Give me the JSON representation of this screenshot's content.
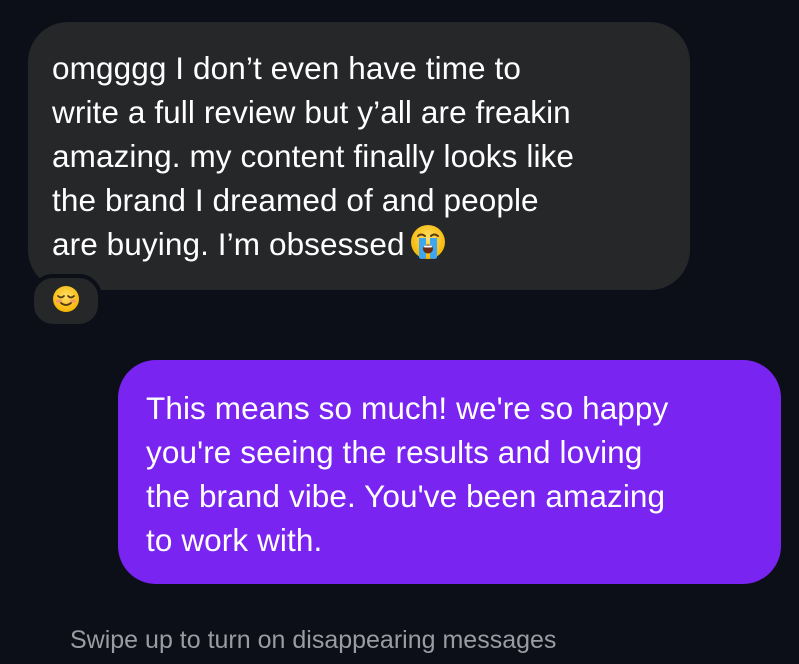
{
  "thread": {
    "incoming": {
      "lines": [
        "omgggg I don’t even have time to",
        "write a full review but y’all are freakin",
        "amazing. my content finally looks like",
        "the brand I dreamed of and people",
        "are buying. I’m obsessed"
      ],
      "trailing_emoji_icon": "loudly-crying-face-icon",
      "reaction_icon": "smiling-face-icon"
    },
    "outgoing": {
      "lines": [
        "This means so much! we're so happy",
        "you're seeing the results and loving",
        "the brand vibe. You've been amazing",
        "to work with."
      ]
    }
  },
  "footer": {
    "hint": "Swipe up to turn on disappearing messages"
  },
  "colors": {
    "background": "#0c0e18",
    "incoming_bubble": "#262729",
    "outgoing_bubble": "#7a24f2",
    "hint_text": "#9a9ca3"
  }
}
